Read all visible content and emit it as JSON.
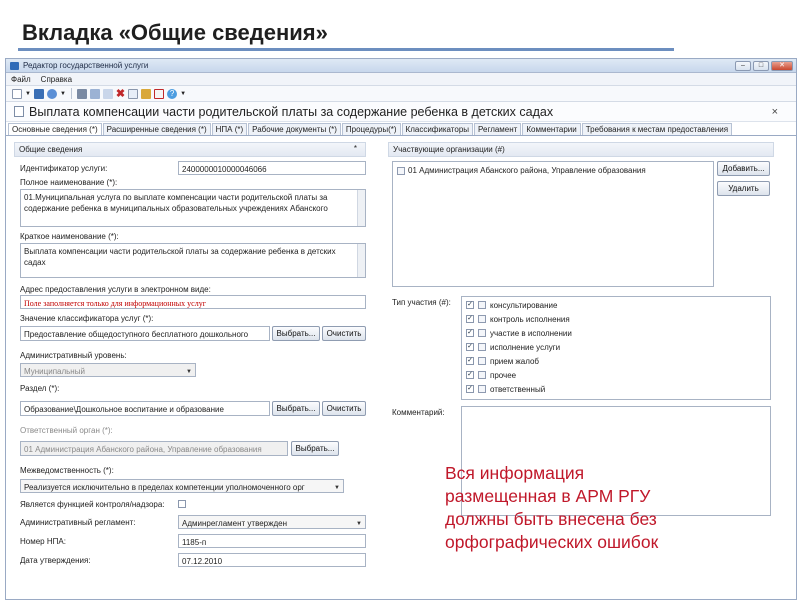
{
  "slide": {
    "title": "Вкладка «Общие сведения»"
  },
  "window": {
    "title": "Редактор государственной услуги",
    "buttons": [
      "–",
      "□",
      "✕"
    ]
  },
  "menu": [
    "Файл",
    "Справка"
  ],
  "document": {
    "title": "Выплата компенсации части родительской платы за содержание ребенка в детских садах",
    "close": "×"
  },
  "tabs": [
    "Основные сведения (*)",
    "Расширенные сведения (*)",
    "НПА (*)",
    "Рабочие документы (*)",
    "Процедуры(*)",
    "Классификаторы",
    "Регламент",
    "Комментарии",
    "Требования к местам предоставления"
  ],
  "left": {
    "section": "Общие сведения",
    "section_marker": "*",
    "service_id_label": "Идентификатор услуги:",
    "service_id": "2400000010000046066",
    "full_name_label": "Полное наименование (*):",
    "full_name": "01.Муниципальная услуга по выплате компенсации части родительской платы за содержание ребенка в муниципальных образовательных учреждениях Абанского",
    "short_name_label": "Краткое наименование (*):",
    "short_name": "Выплата компенсации части родительской платы за содержание ребенка в детских садах",
    "address_label": "Адрес предоставления услуги в электронном виде:",
    "address_note": "Поле заполняется только для информационных услуг",
    "classifier_label": "Значение классификатора услуг (*):",
    "classifier": "Предоставление общедоступного бесплатного дошкольного",
    "select_btn": "Выбрать...",
    "clear_btn": "Очистить",
    "admin_level_label": "Административный уровень:",
    "admin_level": "Муниципальный",
    "section_label": "Раздел (*):",
    "section_value": "Образование\\Дошкольное воспитание и образование",
    "resp_label": "Ответственный орган (*):",
    "resp_value": "01 Администрация Абанского района, Управление образования",
    "interdept_label": "Межведомственность (*):",
    "interdept_value": "Реализуется исключительно в пределах компетенции уполномоченного орг",
    "control_label": "Является функцией контроля/надзора:",
    "regulation_label": "Административный регламент:",
    "regulation_value": "Админрегламент утвержден",
    "npa_label": "Номер НПА:",
    "npa_value": "1185-п",
    "date_label": "Дата утверждения:",
    "date_value": "07.12.2010"
  },
  "right": {
    "section": "Участвующие организации (#)",
    "org": "01 Администрация Абанского района, Управление образования",
    "add_btn": "Добавить...",
    "delete_btn": "Удалить",
    "participation_label": "Тип участия (#):",
    "participation": [
      {
        "label": "консультирование",
        "checked": true
      },
      {
        "label": "контроль исполнения",
        "checked": true
      },
      {
        "label": "участие в исполнении",
        "checked": true
      },
      {
        "label": "исполнение услуги",
        "checked": true
      },
      {
        "label": "прием жалоб",
        "checked": true
      },
      {
        "label": "прочее",
        "checked": true
      },
      {
        "label": "ответственный",
        "checked": true
      }
    ],
    "comment_label": "Комментарий:"
  },
  "overlay": {
    "line1": "Вся информация",
    "line2": "размещенная в АРМ РГУ",
    "line3": "должны быть внесена без",
    "line4": "орфографических ошибок"
  }
}
